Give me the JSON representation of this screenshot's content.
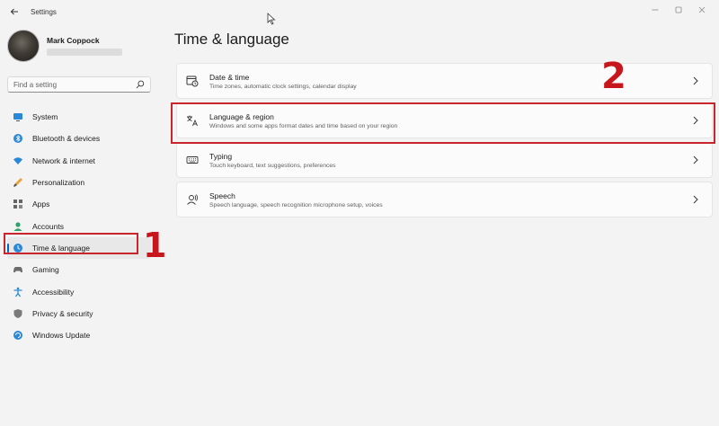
{
  "window": {
    "app_title": "Settings",
    "back_icon": "back-arrow-icon",
    "controls": [
      "minimize-icon",
      "maximize-icon",
      "close-icon"
    ]
  },
  "profile": {
    "name": "Mark Coppock"
  },
  "search": {
    "placeholder": "Find a setting",
    "value": ""
  },
  "sidebar": {
    "items": [
      {
        "label": "System",
        "icon": "monitor-icon",
        "selected": false
      },
      {
        "label": "Bluetooth & devices",
        "icon": "bluetooth-icon",
        "selected": false
      },
      {
        "label": "Network & internet",
        "icon": "wifi-icon",
        "selected": false
      },
      {
        "label": "Personalization",
        "icon": "brush-icon",
        "selected": false
      },
      {
        "label": "Apps",
        "icon": "apps-icon",
        "selected": false
      },
      {
        "label": "Accounts",
        "icon": "person-icon",
        "selected": false
      },
      {
        "label": "Time & language",
        "icon": "globe-clock-icon",
        "selected": true
      },
      {
        "label": "Gaming",
        "icon": "controller-icon",
        "selected": false
      },
      {
        "label": "Accessibility",
        "icon": "accessibility-icon",
        "selected": false
      },
      {
        "label": "Privacy & security",
        "icon": "shield-icon",
        "selected": false
      },
      {
        "label": "Windows Update",
        "icon": "update-icon",
        "selected": false
      }
    ]
  },
  "main": {
    "title": "Time & language",
    "cards": [
      {
        "title": "Date & time",
        "description": "Time zones, automatic clock settings, calendar display",
        "icon": "calendar-clock-icon"
      },
      {
        "title": "Language & region",
        "description": "Windows and some apps format dates and time based on your region",
        "icon": "language-icon"
      },
      {
        "title": "Typing",
        "description": "Touch keyboard, text suggestions, preferences",
        "icon": "keyboard-icon"
      },
      {
        "title": "Speech",
        "description": "Speech language, speech recognition microphone setup, voices",
        "icon": "speech-icon"
      }
    ]
  },
  "annotations": {
    "step1": "1",
    "step2": "2"
  },
  "colors": {
    "accent": "#0067c0",
    "annotation_red": "#c8262c",
    "background": "#f3f3f3",
    "card": "#fbfbfb"
  }
}
